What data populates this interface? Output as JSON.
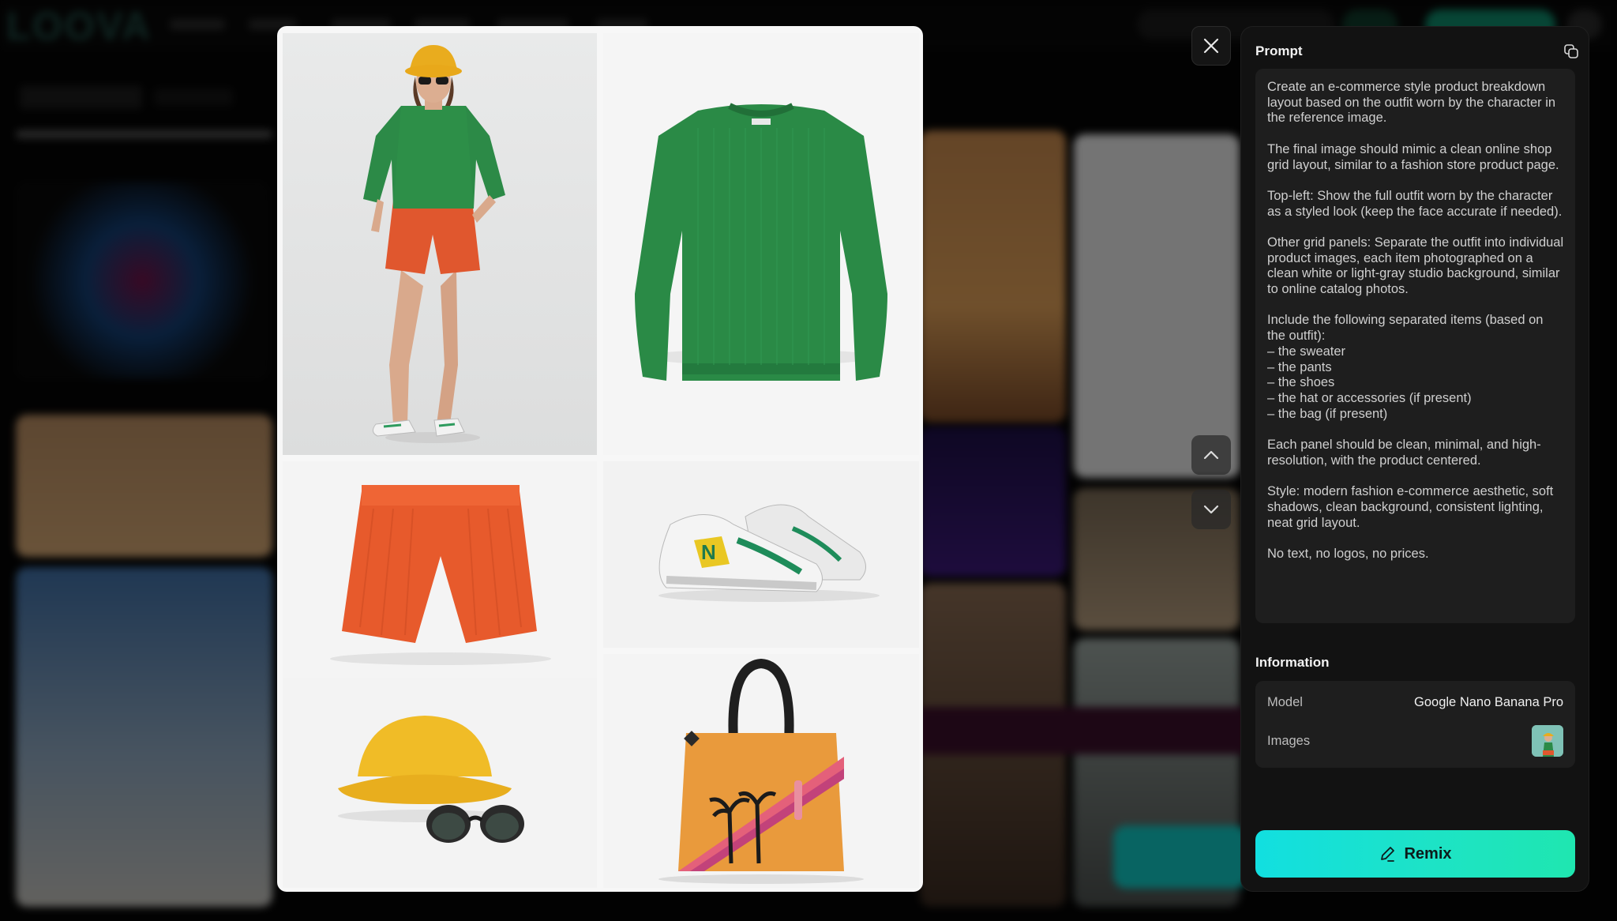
{
  "background": {
    "logo": "LOOVA"
  },
  "panel": {
    "prompt_title": "Prompt",
    "prompt_paragraphs": [
      "Create an e-commerce style product breakdown layout based on the outfit worn by the character in the reference image.",
      "The final image should mimic a clean online shop grid layout, similar to a fashion store product page.",
      "Top-left: Show the full outfit worn by the character as a styled look (keep the face accurate if needed).",
      "Other grid panels: Separate the outfit into individual product images, each item photographed on a clean white or light-gray studio background, similar to online catalog photos.",
      "Include the following separated items (based on the outfit):\n– the sweater\n– the pants\n– the shoes\n– the hat or accessories (if present)\n– the bag (if present)",
      "Each panel should be clean, minimal, and high-resolution, with the product centered.",
      "Style: modern fashion e-commerce aesthetic, soft shadows, clean background, consistent lighting, neat grid layout.",
      "No text, no logos, no prices."
    ],
    "info_title": "Information",
    "model_label": "Model",
    "model_value": "Google Nano Banana Pro",
    "images_label": "Images",
    "remix_label": "Remix"
  },
  "icons": {
    "close": "close-icon",
    "copy": "copy-icon",
    "prev": "chevron-up-icon",
    "next": "chevron-down-icon",
    "remix": "pencil-icon"
  },
  "colors": {
    "accent_start": "#12dfe0",
    "accent_end": "#1fe6b0",
    "panel_bg": "#121212",
    "box_bg": "#1e1e1e"
  }
}
